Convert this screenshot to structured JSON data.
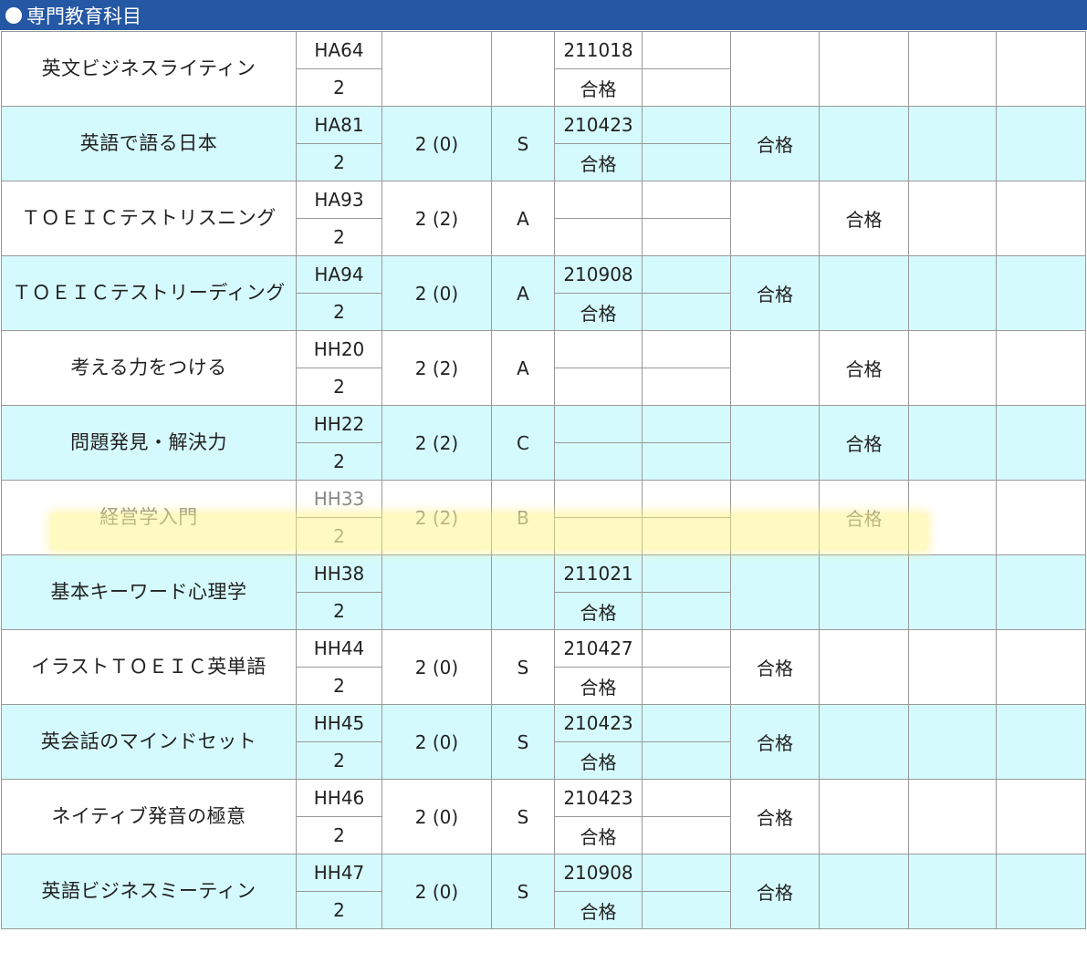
{
  "section": {
    "title": "専門教育科目"
  },
  "rows": [
    {
      "name": "英文ビジネスライティン",
      "code": "HA64",
      "units": "2",
      "credit": "",
      "grade": "",
      "date": "211018",
      "date_result": "合格",
      "col6": "",
      "col7": "",
      "bg": "white"
    },
    {
      "name": "英語で語る日本",
      "code": "HA81",
      "units": "2",
      "credit": "2 (0)",
      "grade": "S",
      "date": "210423",
      "date_result": "合格",
      "col6": "合格",
      "col7": "",
      "bg": "cyan"
    },
    {
      "name": "ＴＯＥＩＣテストリスニング",
      "code": "HA93",
      "units": "2",
      "credit": "2 (2)",
      "grade": "A",
      "date": "",
      "date_result": "",
      "col6": "",
      "col7": "合格",
      "bg": "white"
    },
    {
      "name": "ＴＯＥＩＣテストリーディング",
      "code": "HA94",
      "units": "2",
      "credit": "2 (0)",
      "grade": "A",
      "date": "210908",
      "date_result": "合格",
      "col6": "合格",
      "col7": "",
      "bg": "cyan"
    },
    {
      "name": "考える力をつける",
      "code": "HH20",
      "units": "2",
      "credit": "2 (2)",
      "grade": "A",
      "date": "",
      "date_result": "",
      "col6": "",
      "col7": "合格",
      "bg": "white"
    },
    {
      "name": "問題発見・解決力",
      "code": "HH22",
      "units": "2",
      "credit": "2 (2)",
      "grade": "C",
      "date": "",
      "date_result": "",
      "col6": "",
      "col7": "合格",
      "bg": "cyan"
    },
    {
      "name": "経営学入門",
      "code": "HH33",
      "units": "2",
      "credit": "2 (2)",
      "grade": "B",
      "date": "",
      "date_result": "",
      "col6": "",
      "col7": "合格",
      "bg": "white",
      "highlight": true
    },
    {
      "name": "基本キーワード心理学",
      "code": "HH38",
      "units": "2",
      "credit": "",
      "grade": "",
      "date": "211021",
      "date_result": "合格",
      "col6": "",
      "col7": "",
      "bg": "cyan"
    },
    {
      "name": "イラストＴＯＥＩＣ英単語",
      "code": "HH44",
      "units": "2",
      "credit": "2 (0)",
      "grade": "S",
      "date": "210427",
      "date_result": "合格",
      "col6": "合格",
      "col7": "",
      "bg": "white"
    },
    {
      "name": "英会話のマインドセット",
      "code": "HH45",
      "units": "2",
      "credit": "2 (0)",
      "grade": "S",
      "date": "210423",
      "date_result": "合格",
      "col6": "合格",
      "col7": "",
      "bg": "cyan"
    },
    {
      "name": "ネイティブ発音の極意",
      "code": "HH46",
      "units": "2",
      "credit": "2 (0)",
      "grade": "S",
      "date": "210423",
      "date_result": "合格",
      "col6": "合格",
      "col7": "",
      "bg": "white"
    },
    {
      "name": "英語ビジネスミーティン",
      "code": "HH47",
      "units": "2",
      "credit": "2 (0)",
      "grade": "S",
      "date": "210908",
      "date_result": "合格",
      "col6": "合格",
      "col7": "",
      "bg": "cyan"
    }
  ],
  "colors": {
    "header_bg": "#2457a4",
    "row_alt_bg": "#d5fafd",
    "highlight": "#fff278",
    "border": "#999999"
  }
}
